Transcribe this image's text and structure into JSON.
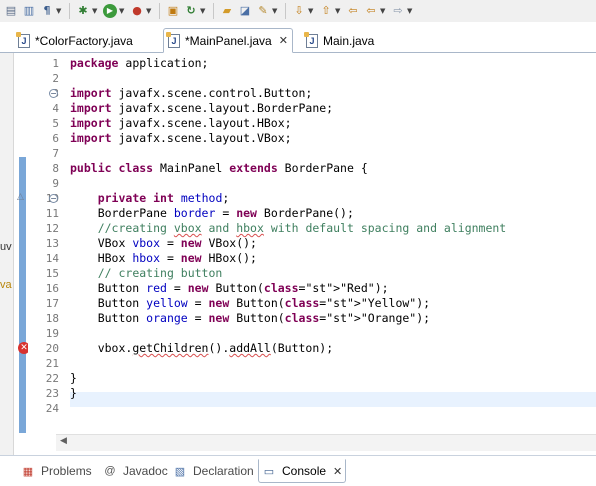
{
  "toolbar": {
    "icons": [
      "print-icon",
      "save-all-icon",
      "paragraph-icon",
      "debug-icon",
      "run-icon",
      "coverage-icon",
      "new-class-icon",
      "refresh-icon",
      "open-folder-icon",
      "pencil-icon",
      "next-annotation-icon",
      "prev-annotation-icon",
      "back-icon",
      "forward-icon"
    ]
  },
  "tabs": [
    {
      "label": "*ColorFactory.java",
      "icon": "java-file-icon",
      "active": false
    },
    {
      "label": "*MainPanel.java",
      "icon": "java-file-icon",
      "active": true,
      "close": "✕"
    },
    {
      "label": "Main.java",
      "icon": "java-file-icon",
      "active": false
    }
  ],
  "left_strip": {
    "text_top": "uv",
    "text_bottom": "va"
  },
  "editor": {
    "line_numbers": [
      "1",
      "2",
      "3",
      "4",
      "5",
      "6",
      "7",
      "8",
      "9",
      "10",
      "11",
      "12",
      "13",
      "14",
      "15",
      "16",
      "17",
      "18",
      "19",
      "20",
      "21",
      "22",
      "23",
      "24"
    ],
    "lines": [
      "package application;",
      "",
      "import javafx.scene.control.Button;",
      "import javafx.scene.layout.BorderPane;",
      "import javafx.scene.layout.HBox;",
      "import javafx.scene.layout.VBox;",
      "",
      "public class MainPanel extends BorderPane {",
      "",
      "    private int method;",
      "    BorderPane border = new BorderPane();",
      "    //creating vbox and hbox with default spacing and alignment",
      "    VBox vbox = new VBox();",
      "    HBox hbox = new HBox();",
      "    // creating button",
      "    Button red = new Button(\"Red\");",
      "    Button yellow = new Button(\"Yellow\");",
      "    Button orange = new Button(\"Orange\");",
      "",
      "    vbox.getChildren().addAll(Button);",
      "",
      "}",
      "}",
      ""
    ],
    "error_line": 20,
    "current_line": 20,
    "colors": {
      "keyword": "#7f0055",
      "field": "#0000c0",
      "comment": "#3f7f5f",
      "string": "#2a00ff",
      "error": "#d8322f",
      "current_line": "#e8f2fe"
    }
  },
  "bottom_tabs": [
    {
      "label": "Problems",
      "icon": "problems-icon",
      "active": false
    },
    {
      "label": "Javadoc",
      "icon": "at-icon",
      "active": false
    },
    {
      "label": "Declaration",
      "icon": "declaration-icon",
      "active": false
    },
    {
      "label": "Console",
      "icon": "console-icon",
      "active": true,
      "close": "✕"
    }
  ]
}
